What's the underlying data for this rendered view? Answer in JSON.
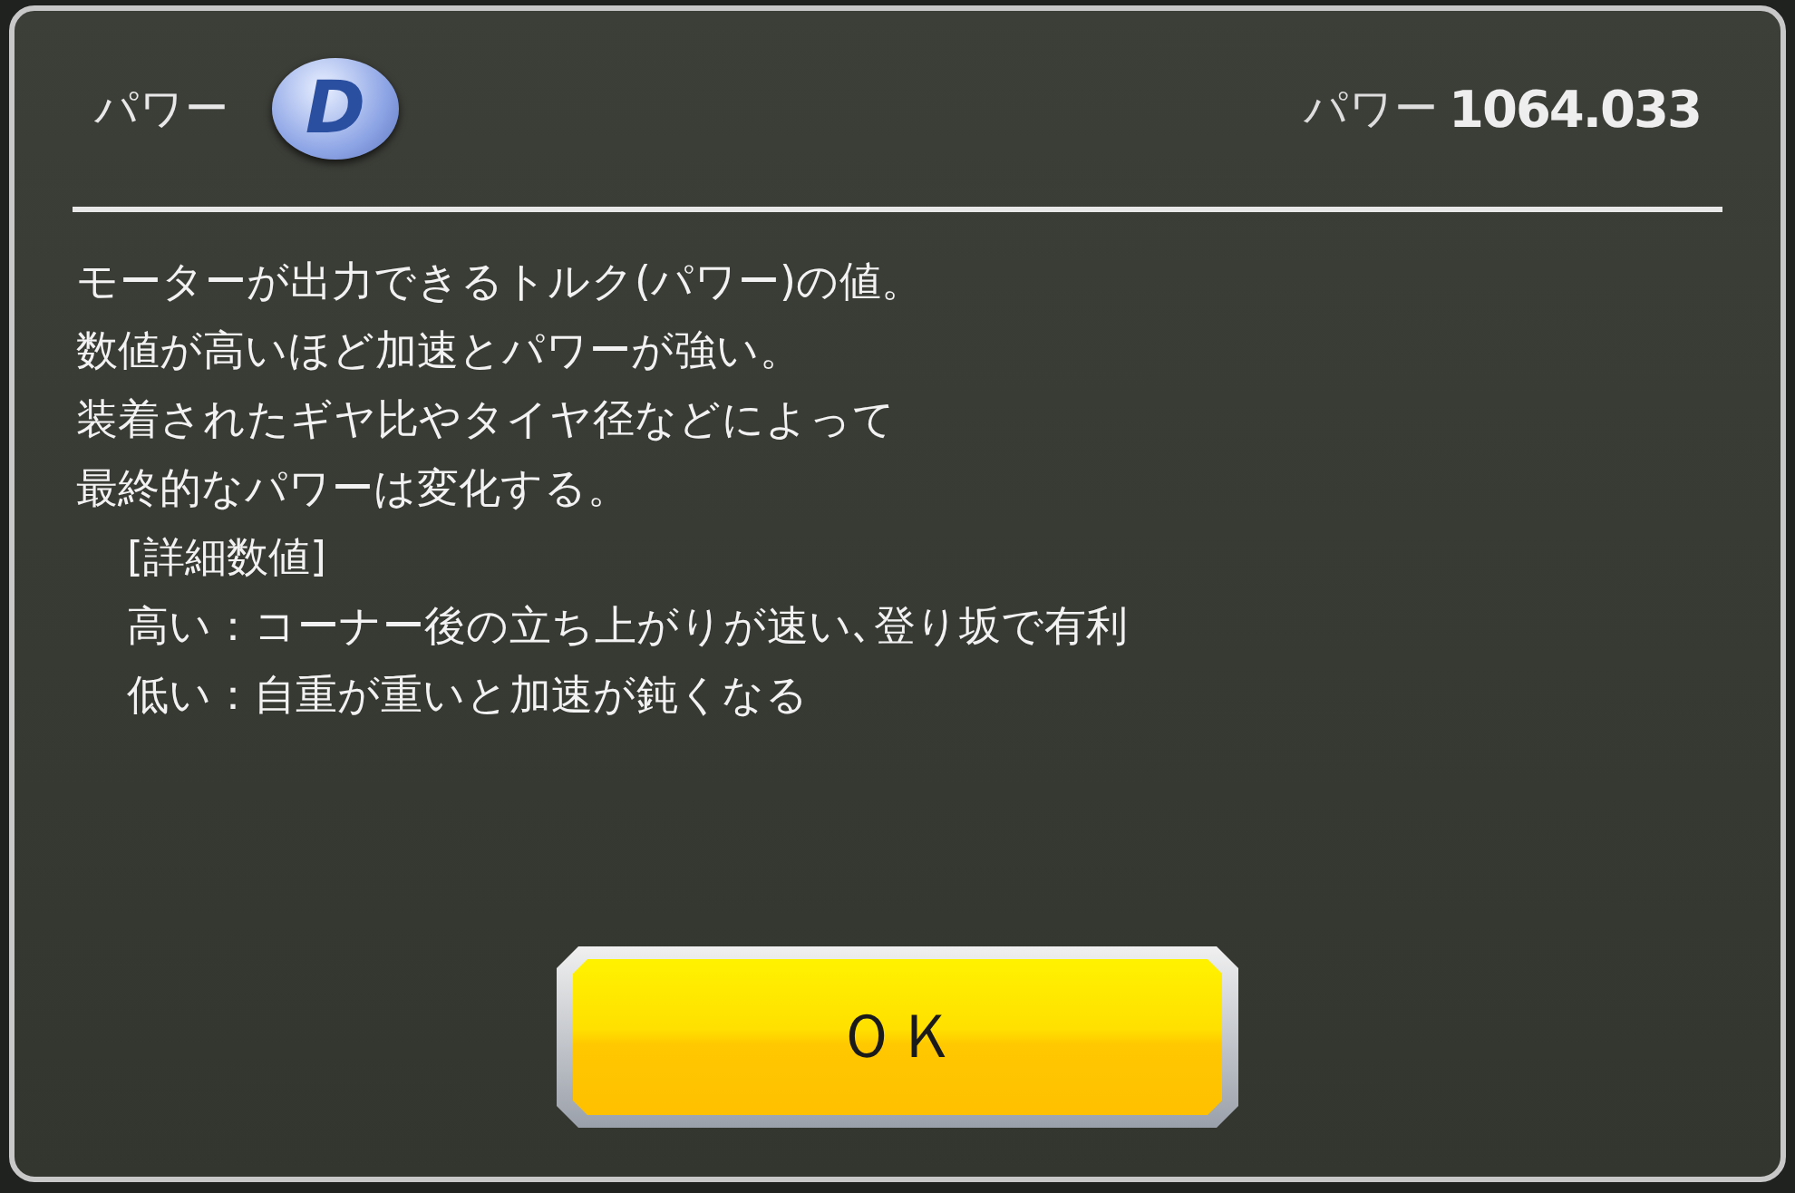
{
  "header": {
    "title": "パワー",
    "grade": "D",
    "value_label": "パワー",
    "value": "1064.033"
  },
  "description": [
    "モーターが出力できるトルク(パワー)の値。",
    "数値が高いほど加速とパワーが強い。",
    "装着されたギヤ比やタイヤ径などによって",
    "最終的なパワーは変化する。"
  ],
  "details": {
    "heading": "[詳細数値]",
    "items": [
      "高い：コーナー後の立ち上がりが速い､登り坂で有利",
      "低い：自重が重いと加速が鈍くなる"
    ]
  },
  "buttons": [
    "ＯＫ"
  ]
}
